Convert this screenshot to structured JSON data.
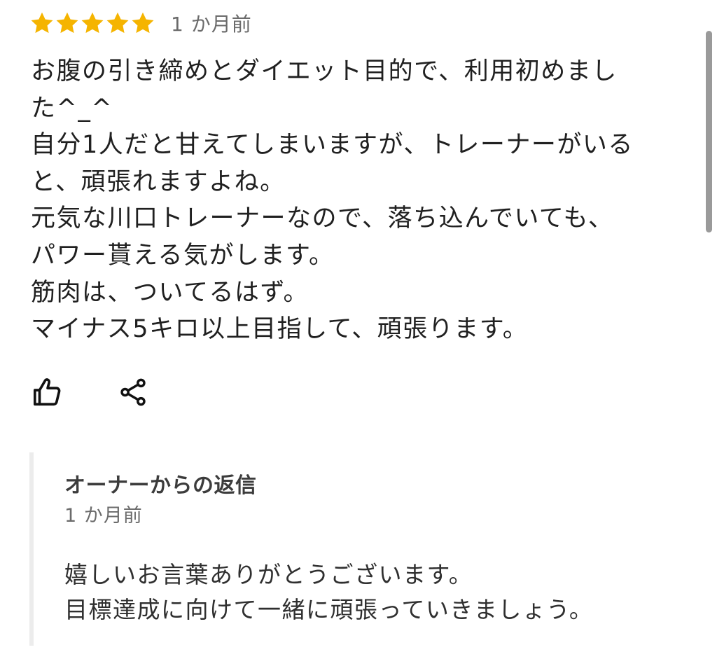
{
  "review": {
    "rating": 5,
    "max_rating": 5,
    "star_color": "#F5B400",
    "time_ago": "1 か月前",
    "text_lines": [
      "お腹の引き締めとダイエット目的で、利用初めまし",
      "た^_^",
      "自分1人だと甘えてしまいますが、トレーナーがいる",
      "と、頑張れますよね。",
      "元気な川口トレーナーなので、落ち込んでいても、",
      "パワー貰える気がします。",
      "筋肉は、ついてるはず。",
      "マイナス5キロ以上目指して、頑張ります。"
    ]
  },
  "actions": {
    "like_icon": "thumbs-up-icon",
    "share_icon": "share-icon"
  },
  "owner_reply": {
    "title": "オーナーからの返信",
    "time_ago": "1 か月前",
    "text_lines": [
      "嬉しいお言葉ありがとうございます。",
      "目標達成に向けて一緒に頑張っていきましょう。"
    ]
  }
}
